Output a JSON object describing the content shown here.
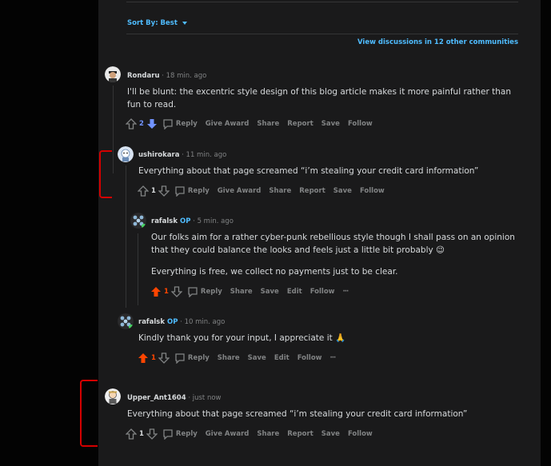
{
  "sort": {
    "label": "Sort By: Best"
  },
  "view_discussions": "View discussions in 12 other communities",
  "comments": [
    {
      "author": "Rondaru",
      "time": "· 18 min. ago",
      "text": "I'll be blunt: the excentric style design of this blog article makes it more painful rather than fun to read.",
      "score": "2",
      "actions": [
        "Reply",
        "Give Award",
        "Share",
        "Report",
        "Save",
        "Follow"
      ]
    },
    {
      "author": "ushirokara",
      "time": "· 11 min. ago",
      "text": "Everything about that page screamed “i’m stealing your credit card information”",
      "score": "1",
      "actions": [
        "Reply",
        "Give Award",
        "Share",
        "Report",
        "Save",
        "Follow"
      ]
    },
    {
      "author": "rafalsk",
      "op": "OP",
      "time": "· 5 min. ago",
      "text": "Our folks aim for a rather cyber-punk rebellious style though I shall pass on an opinion that they could balance the looks and feels just a little bit probably 😉",
      "text2": "Everything is free, we collect no payments just to be clear.",
      "score": "1",
      "actions": [
        "Reply",
        "Share",
        "Save",
        "Edit",
        "Follow"
      ],
      "more": "···"
    },
    {
      "author": "rafalsk",
      "op": "OP",
      "time": "· 10 min. ago",
      "text": "Kindly thank you for your input, I appreciate it 🙏",
      "score": "1",
      "actions": [
        "Reply",
        "Share",
        "Save",
        "Edit",
        "Follow"
      ],
      "more": "···"
    },
    {
      "author": "Upper_Ant1604",
      "time": "· just now",
      "text": "Everything about that page screamed “i’m stealing your credit card information”",
      "score": "1",
      "actions": [
        "Reply",
        "Give Award",
        "Share",
        "Report",
        "Save",
        "Follow"
      ]
    }
  ],
  "colors": {
    "upvote_active": "#ff4500",
    "downvote_active": "#7193ff",
    "link": "#4fbcff",
    "red_annotation": "#d40000"
  },
  "icons": [
    "upvote-icon",
    "downvote-icon",
    "comment-icon",
    "more-icon",
    "caret-down-icon"
  ]
}
